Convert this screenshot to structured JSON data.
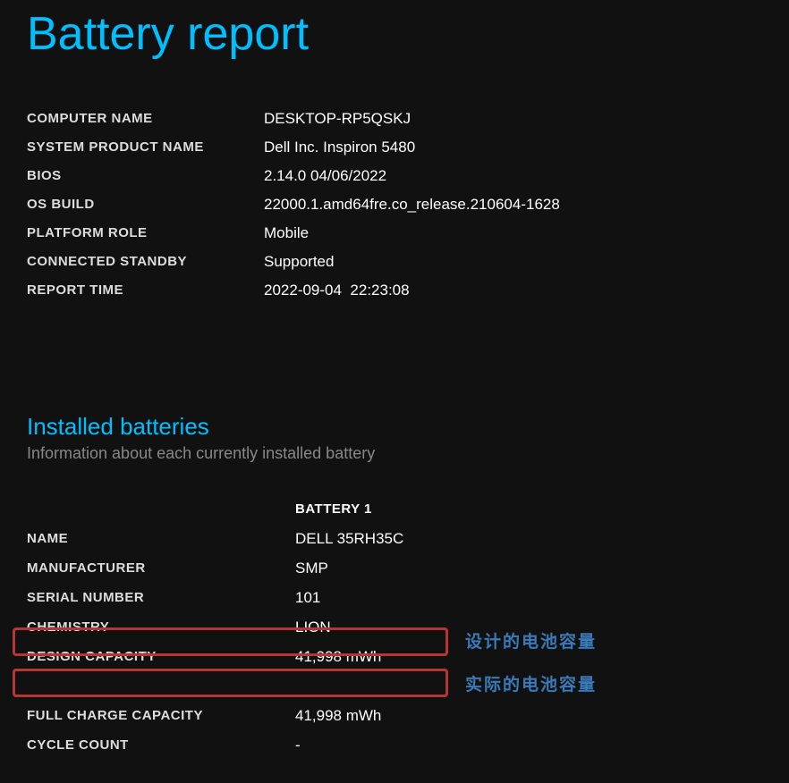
{
  "title": "Battery report",
  "system_info": {
    "computer_name_label": "COMPUTER NAME",
    "computer_name_value": "DESKTOP-RP5QSKJ",
    "system_product_label": "SYSTEM PRODUCT NAME",
    "system_product_value": "Dell Inc. Inspiron 5480",
    "bios_label": "BIOS",
    "bios_value": "2.14.0 04/06/2022",
    "os_build_label": "OS BUILD",
    "os_build_value": "22000.1.amd64fre.co_release.210604-1628",
    "platform_role_label": "PLATFORM ROLE",
    "platform_role_value": "Mobile",
    "connected_standby_label": "CONNECTED STANDBY",
    "connected_standby_value": "Supported",
    "report_time_label": "REPORT TIME",
    "report_time_value": "2022-09-04  22:23:08"
  },
  "batteries_section": {
    "title": "Installed batteries",
    "subtitle": "Information about each currently installed battery",
    "header": "BATTERY 1",
    "name_label": "NAME",
    "name_value": "DELL 35RH35C",
    "manufacturer_label": "MANUFACTURER",
    "manufacturer_value": "SMP",
    "serial_label": "SERIAL NUMBER",
    "serial_value": "101",
    "chemistry_label": "CHEMISTRY",
    "chemistry_value": "LION",
    "design_capacity_label": "DESIGN CAPACITY",
    "design_capacity_value": "41,998 mWh",
    "full_charge_label": "FULL CHARGE CAPACITY",
    "full_charge_value": "41,998 mWh",
    "cycle_count_label": "CYCLE COUNT",
    "cycle_count_value": "-"
  },
  "annotations": {
    "design": "设计的电池容量",
    "actual": "实际的电池容量"
  }
}
